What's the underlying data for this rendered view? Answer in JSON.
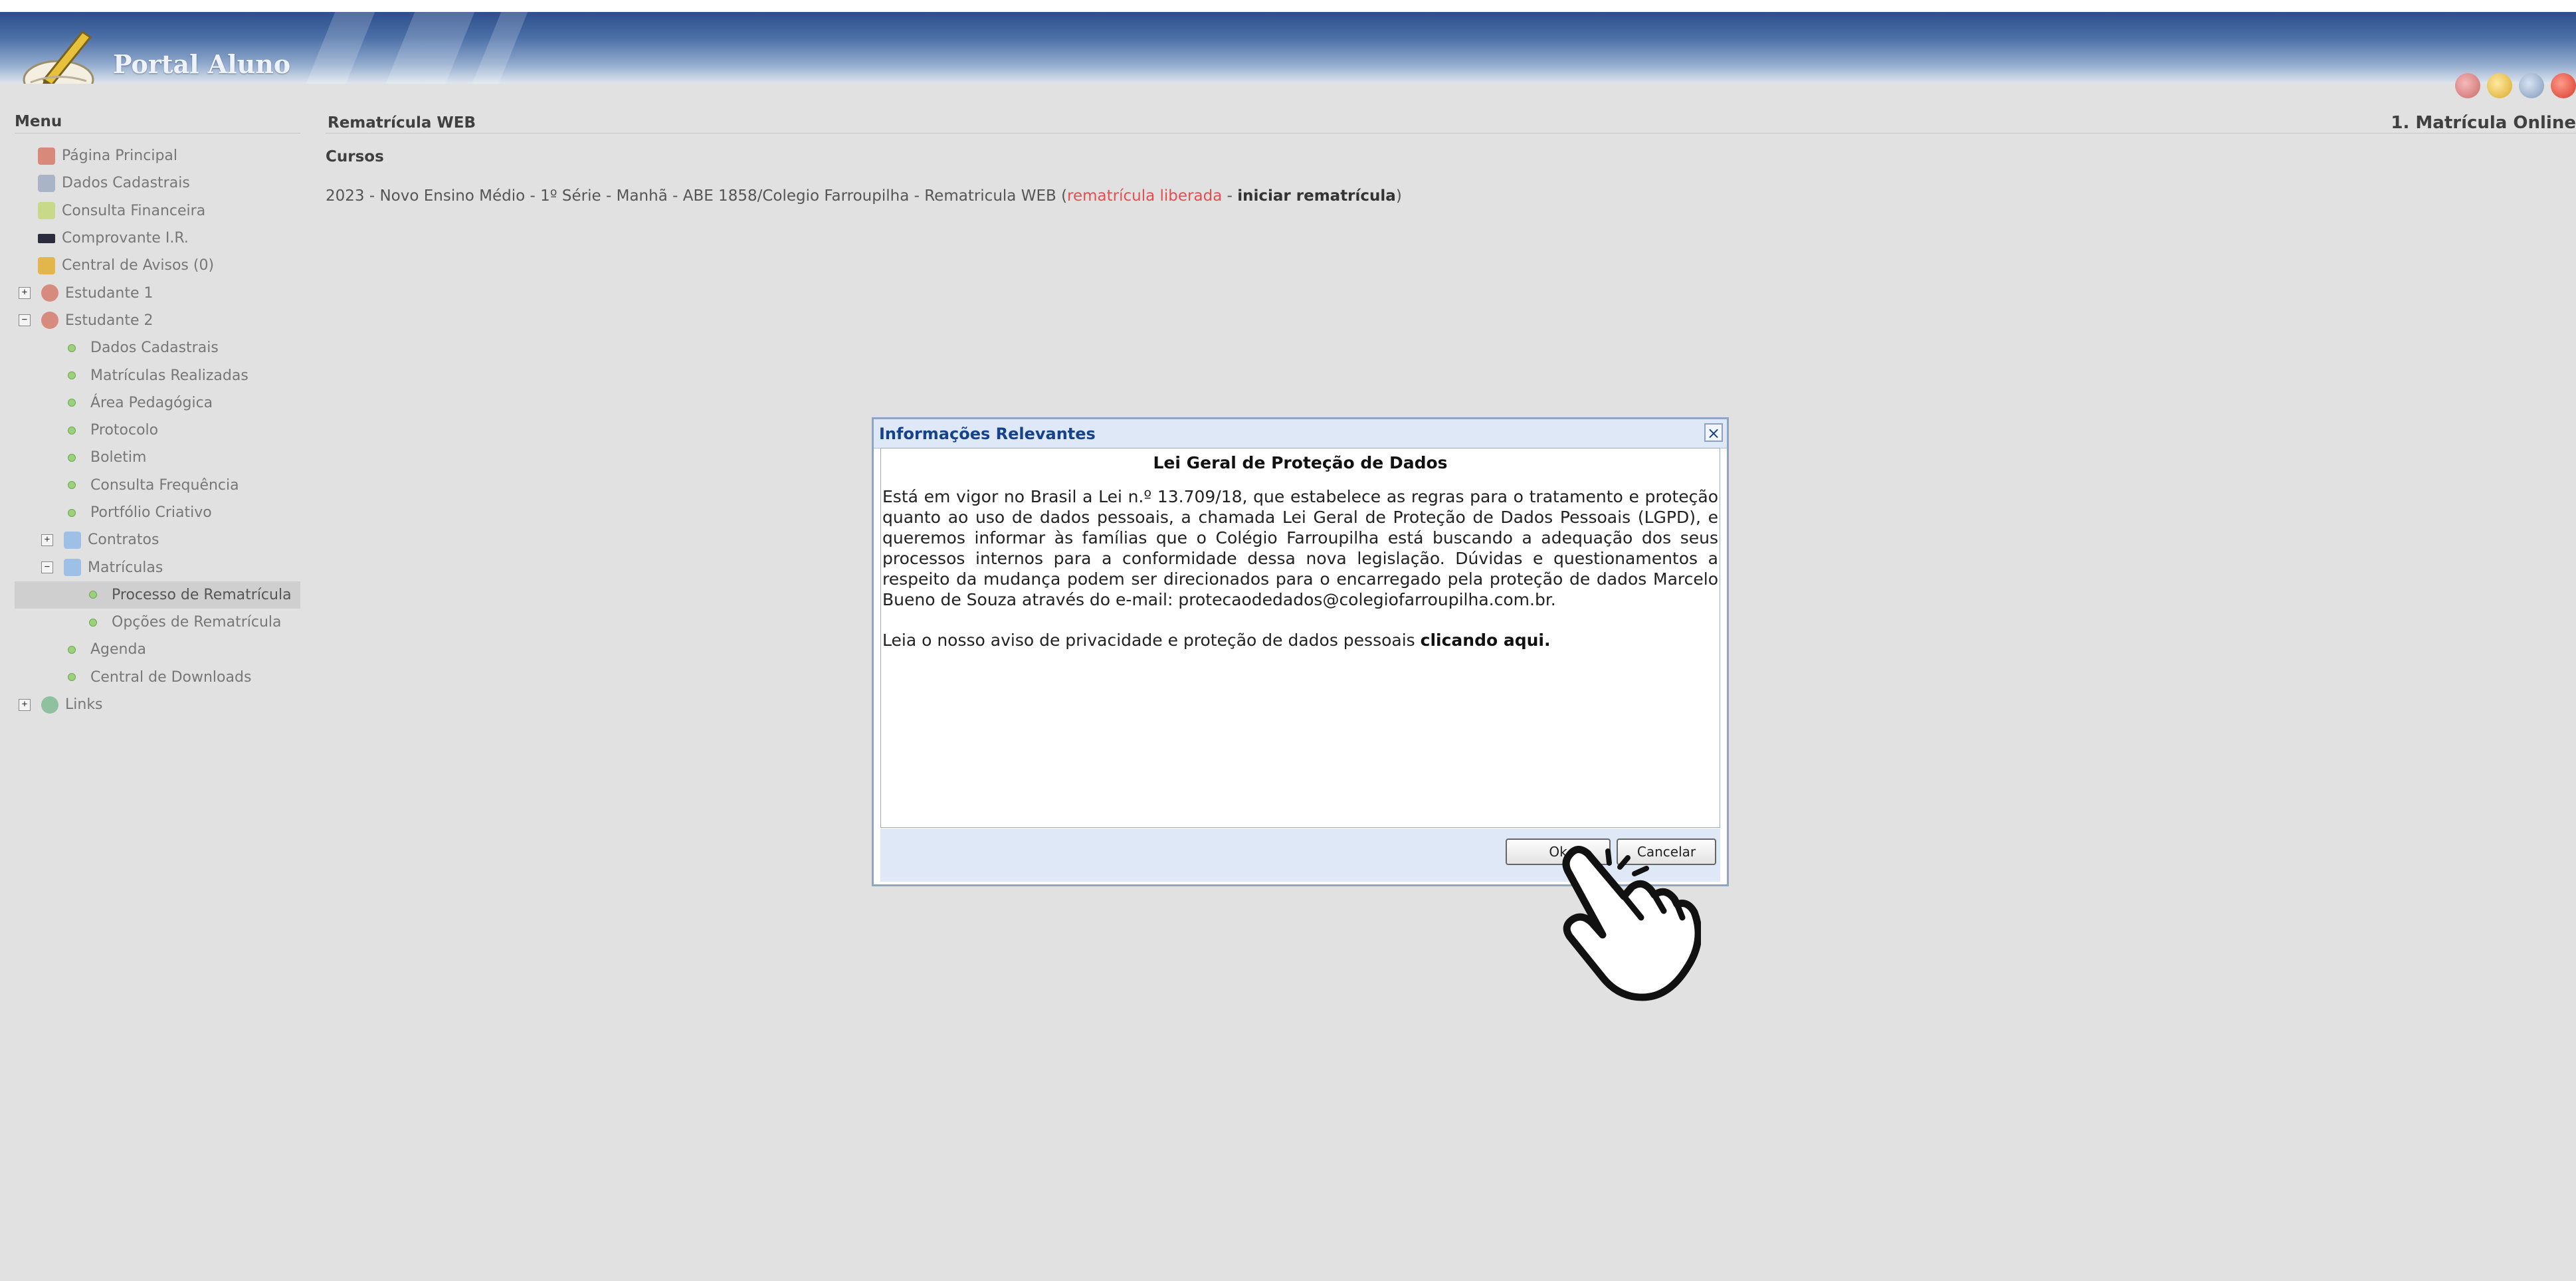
{
  "app": {
    "brand": "Portal Aluno"
  },
  "menu": {
    "title": "Menu",
    "items": [
      {
        "label": "Página Principal"
      },
      {
        "label": "Dados Cadastrais"
      },
      {
        "label": "Consulta Financeira"
      },
      {
        "label": "Comprovante I.R."
      },
      {
        "label": "Central de Avisos (0)"
      },
      {
        "label": "Estudante 1"
      },
      {
        "label": "Estudante 2"
      },
      {
        "label": "Dados Cadastrais"
      },
      {
        "label": "Matrículas Realizadas"
      },
      {
        "label": "Área Pedagógica"
      },
      {
        "label": "Protocolo"
      },
      {
        "label": "Boletim"
      },
      {
        "label": "Consulta Frequência"
      },
      {
        "label": "Portfólio Criativo"
      },
      {
        "label": "Contratos"
      },
      {
        "label": "Matrículas"
      },
      {
        "label": "Processo de Rematrícula"
      },
      {
        "label": "Opções de Rematrícula"
      },
      {
        "label": "Agenda"
      },
      {
        "label": "Central de Downloads"
      },
      {
        "label": "Links"
      }
    ]
  },
  "content": {
    "title": "Rematrícula WEB",
    "step": "1. Matrícula Online",
    "section": "Cursos",
    "course": {
      "text": "2023 - Novo Ensino Médio - 1º Série - Manhã - ABE 1858/Colegio Farroupilha - Rematricula WEB (",
      "status": "rematrícula liberada",
      "separator": " - ",
      "action": "iniciar rematrícula",
      "close": ")"
    }
  },
  "dialog": {
    "title": "Informações Relevantes",
    "close": "×",
    "heading": "Lei Geral de Proteção de Dados",
    "paragraph": "Está em vigor no Brasil a Lei n.º 13.709/18, que estabelece as regras para o tratamento e proteção quanto ao uso de dados pessoais, a chamada Lei Geral de Proteção de Dados Pessoais (LGPD), e queremos informar às famílias que o Colégio Farroupilha está buscando a adequação dos seus processos internos para a conformidade dessa nova legislação. Dúvidas e questionamentos a respeito da mudança podem ser direcionados para o encarregado pela proteção de dados Marcelo Bueno de Souza através do e-mail: protecaodedados@colegiofarroupilha.com.br.",
    "privacy_text": "Leia o nosso aviso de privacidade e proteção de dados pessoais ",
    "privacy_link": "clicando aqui.",
    "ok": "Ok",
    "cancel": "Cancelar"
  },
  "icons": {
    "header": [
      "home-icon",
      "key-icon",
      "user-settings-icon",
      "power-icon"
    ],
    "cursor": "hand-pointer-icon"
  },
  "colors": {
    "status_red": "#e05050",
    "dialog_title": "#15428b",
    "header_blue": "#2d4f8c"
  }
}
